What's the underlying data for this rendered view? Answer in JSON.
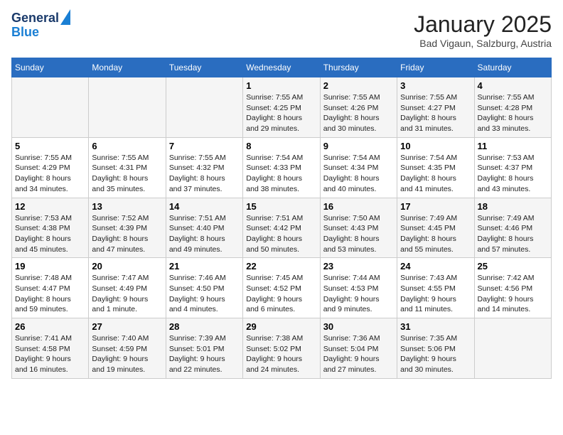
{
  "header": {
    "logo_line1": "General",
    "logo_line2": "Blue",
    "month_year": "January 2025",
    "location": "Bad Vigaun, Salzburg, Austria"
  },
  "weekdays": [
    "Sunday",
    "Monday",
    "Tuesday",
    "Wednesday",
    "Thursday",
    "Friday",
    "Saturday"
  ],
  "weeks": [
    [
      {
        "day": "",
        "info": ""
      },
      {
        "day": "",
        "info": ""
      },
      {
        "day": "",
        "info": ""
      },
      {
        "day": "1",
        "info": "Sunrise: 7:55 AM\nSunset: 4:25 PM\nDaylight: 8 hours\nand 29 minutes."
      },
      {
        "day": "2",
        "info": "Sunrise: 7:55 AM\nSunset: 4:26 PM\nDaylight: 8 hours\nand 30 minutes."
      },
      {
        "day": "3",
        "info": "Sunrise: 7:55 AM\nSunset: 4:27 PM\nDaylight: 8 hours\nand 31 minutes."
      },
      {
        "day": "4",
        "info": "Sunrise: 7:55 AM\nSunset: 4:28 PM\nDaylight: 8 hours\nand 33 minutes."
      }
    ],
    [
      {
        "day": "5",
        "info": "Sunrise: 7:55 AM\nSunset: 4:29 PM\nDaylight: 8 hours\nand 34 minutes."
      },
      {
        "day": "6",
        "info": "Sunrise: 7:55 AM\nSunset: 4:31 PM\nDaylight: 8 hours\nand 35 minutes."
      },
      {
        "day": "7",
        "info": "Sunrise: 7:55 AM\nSunset: 4:32 PM\nDaylight: 8 hours\nand 37 minutes."
      },
      {
        "day": "8",
        "info": "Sunrise: 7:54 AM\nSunset: 4:33 PM\nDaylight: 8 hours\nand 38 minutes."
      },
      {
        "day": "9",
        "info": "Sunrise: 7:54 AM\nSunset: 4:34 PM\nDaylight: 8 hours\nand 40 minutes."
      },
      {
        "day": "10",
        "info": "Sunrise: 7:54 AM\nSunset: 4:35 PM\nDaylight: 8 hours\nand 41 minutes."
      },
      {
        "day": "11",
        "info": "Sunrise: 7:53 AM\nSunset: 4:37 PM\nDaylight: 8 hours\nand 43 minutes."
      }
    ],
    [
      {
        "day": "12",
        "info": "Sunrise: 7:53 AM\nSunset: 4:38 PM\nDaylight: 8 hours\nand 45 minutes."
      },
      {
        "day": "13",
        "info": "Sunrise: 7:52 AM\nSunset: 4:39 PM\nDaylight: 8 hours\nand 47 minutes."
      },
      {
        "day": "14",
        "info": "Sunrise: 7:51 AM\nSunset: 4:40 PM\nDaylight: 8 hours\nand 49 minutes."
      },
      {
        "day": "15",
        "info": "Sunrise: 7:51 AM\nSunset: 4:42 PM\nDaylight: 8 hours\nand 50 minutes."
      },
      {
        "day": "16",
        "info": "Sunrise: 7:50 AM\nSunset: 4:43 PM\nDaylight: 8 hours\nand 53 minutes."
      },
      {
        "day": "17",
        "info": "Sunrise: 7:49 AM\nSunset: 4:45 PM\nDaylight: 8 hours\nand 55 minutes."
      },
      {
        "day": "18",
        "info": "Sunrise: 7:49 AM\nSunset: 4:46 PM\nDaylight: 8 hours\nand 57 minutes."
      }
    ],
    [
      {
        "day": "19",
        "info": "Sunrise: 7:48 AM\nSunset: 4:47 PM\nDaylight: 8 hours\nand 59 minutes."
      },
      {
        "day": "20",
        "info": "Sunrise: 7:47 AM\nSunset: 4:49 PM\nDaylight: 9 hours\nand 1 minute."
      },
      {
        "day": "21",
        "info": "Sunrise: 7:46 AM\nSunset: 4:50 PM\nDaylight: 9 hours\nand 4 minutes."
      },
      {
        "day": "22",
        "info": "Sunrise: 7:45 AM\nSunset: 4:52 PM\nDaylight: 9 hours\nand 6 minutes."
      },
      {
        "day": "23",
        "info": "Sunrise: 7:44 AM\nSunset: 4:53 PM\nDaylight: 9 hours\nand 9 minutes."
      },
      {
        "day": "24",
        "info": "Sunrise: 7:43 AM\nSunset: 4:55 PM\nDaylight: 9 hours\nand 11 minutes."
      },
      {
        "day": "25",
        "info": "Sunrise: 7:42 AM\nSunset: 4:56 PM\nDaylight: 9 hours\nand 14 minutes."
      }
    ],
    [
      {
        "day": "26",
        "info": "Sunrise: 7:41 AM\nSunset: 4:58 PM\nDaylight: 9 hours\nand 16 minutes."
      },
      {
        "day": "27",
        "info": "Sunrise: 7:40 AM\nSunset: 4:59 PM\nDaylight: 9 hours\nand 19 minutes."
      },
      {
        "day": "28",
        "info": "Sunrise: 7:39 AM\nSunset: 5:01 PM\nDaylight: 9 hours\nand 22 minutes."
      },
      {
        "day": "29",
        "info": "Sunrise: 7:38 AM\nSunset: 5:02 PM\nDaylight: 9 hours\nand 24 minutes."
      },
      {
        "day": "30",
        "info": "Sunrise: 7:36 AM\nSunset: 5:04 PM\nDaylight: 9 hours\nand 27 minutes."
      },
      {
        "day": "31",
        "info": "Sunrise: 7:35 AM\nSunset: 5:06 PM\nDaylight: 9 hours\nand 30 minutes."
      },
      {
        "day": "",
        "info": ""
      }
    ]
  ]
}
